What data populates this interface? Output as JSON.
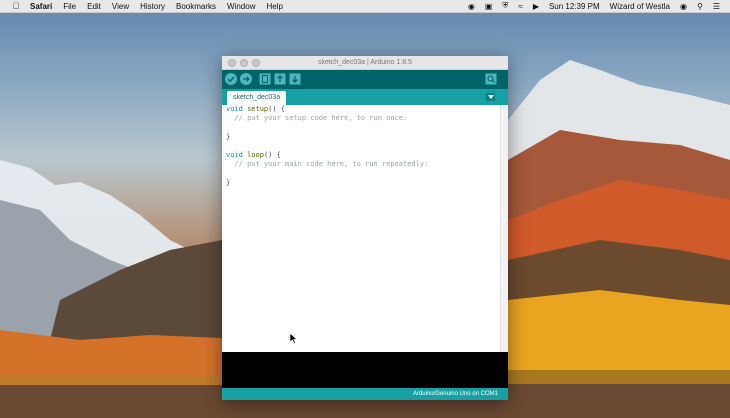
{
  "menubar": {
    "app_name": "Safari",
    "menus": [
      "File",
      "Edit",
      "View",
      "History",
      "Bookmarks",
      "Window",
      "Help"
    ],
    "clock": "Sun 12:39 PM",
    "user": "Wizard of Westla"
  },
  "window": {
    "title": "sketch_dec03a | Arduino 1.8.5",
    "tab_label": "sketch_dec03a",
    "code_lines": [
      "void setup() {",
      "  // put your setup code here, to run once:",
      "",
      "}",
      "",
      "void loop() {",
      "  // put your main code here, to run repeatedly:",
      "",
      "}"
    ],
    "board_status": "Arduino/Genuino Uno on COM1"
  },
  "colors": {
    "toolbar": "#006468",
    "accent": "#17a1a5",
    "console": "#000000"
  },
  "icons": [
    "apple-icon",
    "verify-icon",
    "upload-icon",
    "new-icon",
    "open-icon",
    "save-icon",
    "serial-monitor-icon",
    "tab-menu-icon"
  ]
}
